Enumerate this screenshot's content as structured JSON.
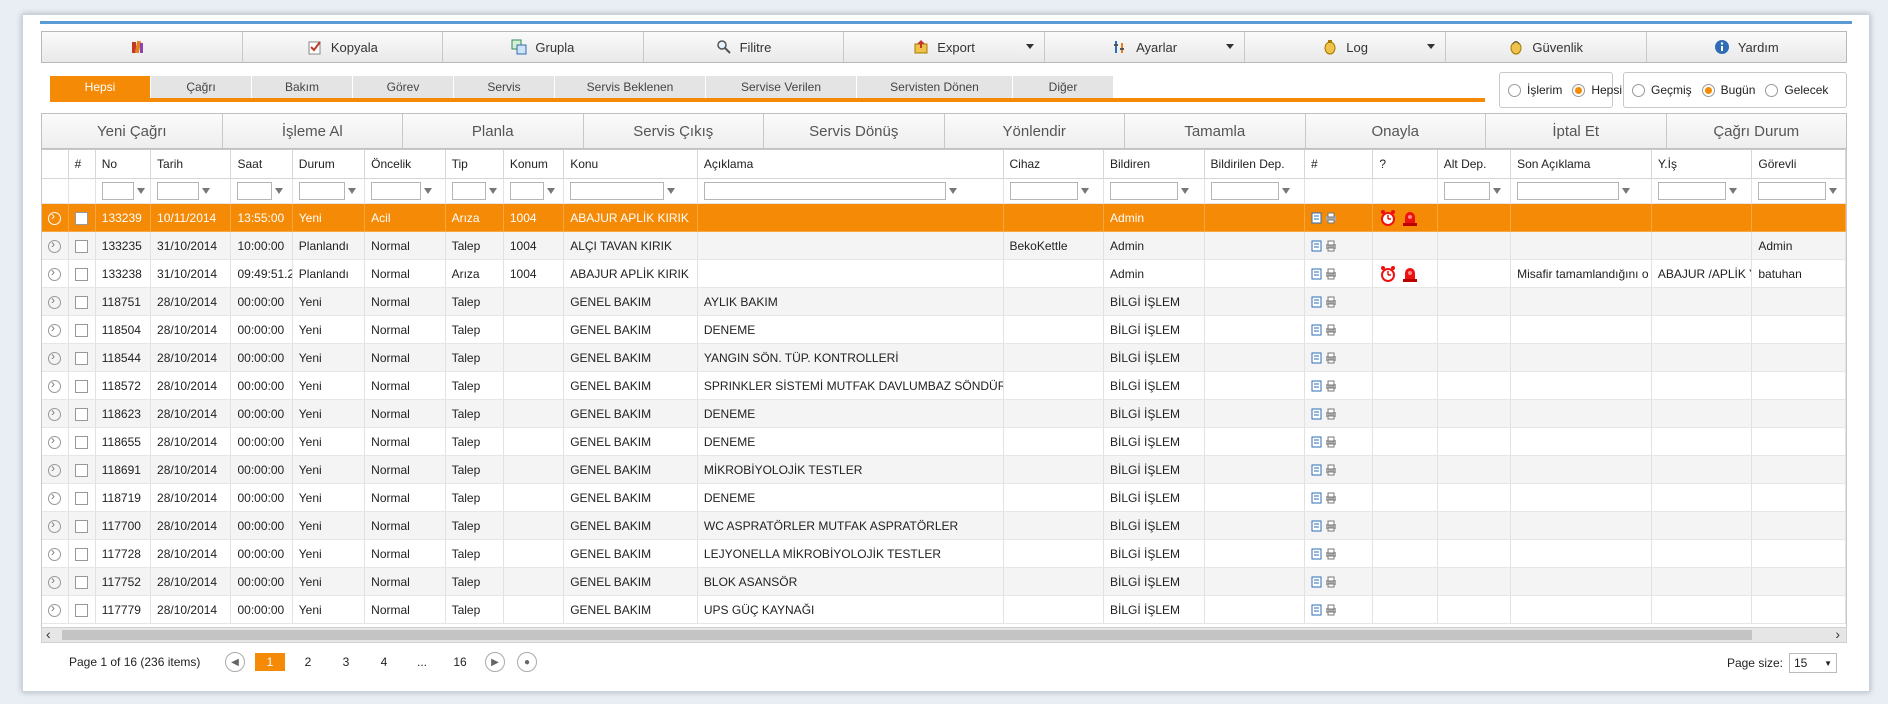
{
  "toolbar": [
    {
      "label": "",
      "icon": "books-icon",
      "dropdown": false
    },
    {
      "label": "Kopyala",
      "icon": "copy-icon",
      "dropdown": false
    },
    {
      "label": "Grupla",
      "icon": "group-icon",
      "dropdown": false
    },
    {
      "label": "Filitre",
      "icon": "magnifier-icon",
      "dropdown": false
    },
    {
      "label": "Export",
      "icon": "export-icon",
      "dropdown": true
    },
    {
      "label": "Ayarlar",
      "icon": "settings-icon",
      "dropdown": true
    },
    {
      "label": "Log",
      "icon": "log-icon",
      "dropdown": true
    },
    {
      "label": "Güvenlik",
      "icon": "security-icon",
      "dropdown": false
    },
    {
      "label": "Yardım",
      "icon": "info-icon",
      "dropdown": false
    }
  ],
  "tabs": [
    "Hepsi",
    "Çağrı",
    "Bakım",
    "Görev",
    "Servis",
    "Servis Beklenen",
    "Servise Verilen",
    "Servisten Dönen",
    "Diğer"
  ],
  "active_tab": "Hepsi",
  "radio_group_1": [
    {
      "label": "İşlerim",
      "checked": false
    },
    {
      "label": "Hepsi",
      "checked": true
    }
  ],
  "radio_group_2": [
    {
      "label": "Geçmiş",
      "checked": false
    },
    {
      "label": "Bugün",
      "checked": true
    },
    {
      "label": "Gelecek",
      "checked": false
    }
  ],
  "actions": [
    "Yeni Çağrı",
    "İşleme Al",
    "Planla",
    "Servis Çıkış",
    "Servis Dönüş",
    "Yönlendir",
    "Tamamla",
    "Onayla",
    "İptal Et",
    "Çağrı Durum"
  ],
  "columns": [
    "",
    "#",
    "No",
    "Tarih",
    "Saat",
    "Durum",
    "Öncelik",
    "Tip",
    "Konum",
    "Konu",
    "Açıklama",
    "Cihaz",
    "Bildiren",
    "Bildirilen Dep.",
    "#",
    "?",
    "Alt Dep.",
    "Son Açıklama",
    "Y.İş",
    "Görevli"
  ],
  "rows": [
    {
      "no": "133239",
      "tarih": "10/11/2014",
      "saat": "13:55:00",
      "durum": "Yeni",
      "oncelik": "Acil",
      "tip": "Arıza",
      "konum": "1004",
      "konu": "ABAJUR APLİK KIRIK",
      "aciklama": "",
      "cihaz": "",
      "bildiren": "Admin",
      "bdep": "",
      "alarm": true,
      "altdep": "",
      "son": "",
      "yis": "",
      "gorevli": "",
      "selected": true
    },
    {
      "no": "133235",
      "tarih": "31/10/2014",
      "saat": "10:00:00",
      "durum": "Planlandı",
      "oncelik": "Normal",
      "tip": "Talep",
      "konum": "1004",
      "konu": "ALÇI TAVAN KIRIK",
      "aciklama": "",
      "cihaz": "BekoKettle",
      "bildiren": "Admin",
      "bdep": "",
      "alarm": false,
      "altdep": "",
      "son": "",
      "yis": "",
      "gorevli": "Admin",
      "selected": false
    },
    {
      "no": "133238",
      "tarih": "31/10/2014",
      "saat": "09:49:51.2",
      "durum": "Planlandı",
      "oncelik": "Normal",
      "tip": "Arıza",
      "konum": "1004",
      "konu": "ABAJUR APLİK KIRIK",
      "aciklama": "",
      "cihaz": "",
      "bildiren": "Admin",
      "bdep": "",
      "alarm": true,
      "altdep": "",
      "son": "Misafir tamamlandığını o",
      "yis": "ABAJUR /APLİK YA",
      "gorevli": "batuhan",
      "selected": false
    },
    {
      "no": "118751",
      "tarih": "28/10/2014",
      "saat": "00:00:00",
      "durum": "Yeni",
      "oncelik": "Normal",
      "tip": "Talep",
      "konum": "",
      "konu": "GENEL BAKIM",
      "aciklama": "AYLIK BAKIM",
      "cihaz": "",
      "bildiren": "BİLGİ İŞLEM",
      "bdep": "",
      "alarm": false,
      "altdep": "",
      "son": "",
      "yis": "",
      "gorevli": "",
      "selected": false
    },
    {
      "no": "118504",
      "tarih": "28/10/2014",
      "saat": "00:00:00",
      "durum": "Yeni",
      "oncelik": "Normal",
      "tip": "Talep",
      "konum": "",
      "konu": "GENEL BAKIM",
      "aciklama": "DENEME",
      "cihaz": "",
      "bildiren": "BİLGİ İŞLEM",
      "bdep": "",
      "alarm": false,
      "altdep": "",
      "son": "",
      "yis": "",
      "gorevli": "",
      "selected": false
    },
    {
      "no": "118544",
      "tarih": "28/10/2014",
      "saat": "00:00:00",
      "durum": "Yeni",
      "oncelik": "Normal",
      "tip": "Talep",
      "konum": "",
      "konu": "GENEL BAKIM",
      "aciklama": "YANGIN SÖN. TÜP. KONTROLLERİ",
      "cihaz": "",
      "bildiren": "BİLGİ İŞLEM",
      "bdep": "",
      "alarm": false,
      "altdep": "",
      "son": "",
      "yis": "",
      "gorevli": "",
      "selected": false
    },
    {
      "no": "118572",
      "tarih": "28/10/2014",
      "saat": "00:00:00",
      "durum": "Yeni",
      "oncelik": "Normal",
      "tip": "Talep",
      "konum": "",
      "konu": "GENEL BAKIM",
      "aciklama": "SPRINKLER SİSTEMİ MUTFAK DAVLUMBAZ SÖNDÜRME",
      "cihaz": "",
      "bildiren": "BİLGİ İŞLEM",
      "bdep": "",
      "alarm": false,
      "altdep": "",
      "son": "",
      "yis": "",
      "gorevli": "",
      "selected": false
    },
    {
      "no": "118623",
      "tarih": "28/10/2014",
      "saat": "00:00:00",
      "durum": "Yeni",
      "oncelik": "Normal",
      "tip": "Talep",
      "konum": "",
      "konu": "GENEL BAKIM",
      "aciklama": "DENEME",
      "cihaz": "",
      "bildiren": "BİLGİ İŞLEM",
      "bdep": "",
      "alarm": false,
      "altdep": "",
      "son": "",
      "yis": "",
      "gorevli": "",
      "selected": false
    },
    {
      "no": "118655",
      "tarih": "28/10/2014",
      "saat": "00:00:00",
      "durum": "Yeni",
      "oncelik": "Normal",
      "tip": "Talep",
      "konum": "",
      "konu": "GENEL BAKIM",
      "aciklama": "DENEME",
      "cihaz": "",
      "bildiren": "BİLGİ İŞLEM",
      "bdep": "",
      "alarm": false,
      "altdep": "",
      "son": "",
      "yis": "",
      "gorevli": "",
      "selected": false
    },
    {
      "no": "118691",
      "tarih": "28/10/2014",
      "saat": "00:00:00",
      "durum": "Yeni",
      "oncelik": "Normal",
      "tip": "Talep",
      "konum": "",
      "konu": "GENEL BAKIM",
      "aciklama": "MİKROBİYOLOJİK TESTLER",
      "cihaz": "",
      "bildiren": "BİLGİ İŞLEM",
      "bdep": "",
      "alarm": false,
      "altdep": "",
      "son": "",
      "yis": "",
      "gorevli": "",
      "selected": false
    },
    {
      "no": "118719",
      "tarih": "28/10/2014",
      "saat": "00:00:00",
      "durum": "Yeni",
      "oncelik": "Normal",
      "tip": "Talep",
      "konum": "",
      "konu": "GENEL BAKIM",
      "aciklama": "DENEME",
      "cihaz": "",
      "bildiren": "BİLGİ İŞLEM",
      "bdep": "",
      "alarm": false,
      "altdep": "",
      "son": "",
      "yis": "",
      "gorevli": "",
      "selected": false
    },
    {
      "no": "117700",
      "tarih": "28/10/2014",
      "saat": "00:00:00",
      "durum": "Yeni",
      "oncelik": "Normal",
      "tip": "Talep",
      "konum": "",
      "konu": "GENEL BAKIM",
      "aciklama": "WC ASPRATÖRLER MUTFAK ASPRATÖRLER",
      "cihaz": "",
      "bildiren": "BİLGİ İŞLEM",
      "bdep": "",
      "alarm": false,
      "altdep": "",
      "son": "",
      "yis": "",
      "gorevli": "",
      "selected": false
    },
    {
      "no": "117728",
      "tarih": "28/10/2014",
      "saat": "00:00:00",
      "durum": "Yeni",
      "oncelik": "Normal",
      "tip": "Talep",
      "konum": "",
      "konu": "GENEL BAKIM",
      "aciklama": "LEJYONELLA MİKROBİYOLOJİK TESTLER",
      "cihaz": "",
      "bildiren": "BİLGİ İŞLEM",
      "bdep": "",
      "alarm": false,
      "altdep": "",
      "son": "",
      "yis": "",
      "gorevli": "",
      "selected": false
    },
    {
      "no": "117752",
      "tarih": "28/10/2014",
      "saat": "00:00:00",
      "durum": "Yeni",
      "oncelik": "Normal",
      "tip": "Talep",
      "konum": "",
      "konu": "GENEL BAKIM",
      "aciklama": "BLOK ASANSÖR",
      "cihaz": "",
      "bildiren": "BİLGİ İŞLEM",
      "bdep": "",
      "alarm": false,
      "altdep": "",
      "son": "",
      "yis": "",
      "gorevli": "",
      "selected": false
    },
    {
      "no": "117779",
      "tarih": "28/10/2014",
      "saat": "00:00:00",
      "durum": "Yeni",
      "oncelik": "Normal",
      "tip": "Talep",
      "konum": "",
      "konu": "GENEL BAKIM",
      "aciklama": "UPS GÜÇ KAYNAĞI",
      "cihaz": "",
      "bildiren": "BİLGİ İŞLEM",
      "bdep": "",
      "alarm": false,
      "altdep": "",
      "son": "",
      "yis": "",
      "gorevli": "",
      "selected": false
    }
  ],
  "pager": {
    "info": "Page 1 of 16 (236 items)",
    "pages": [
      "1",
      "2",
      "3",
      "4",
      "...",
      "16"
    ],
    "current": "1",
    "page_size_label": "Page size:",
    "page_size": "15"
  },
  "colors": {
    "accent": "#f58a07",
    "topline": "#5b9bd5"
  }
}
